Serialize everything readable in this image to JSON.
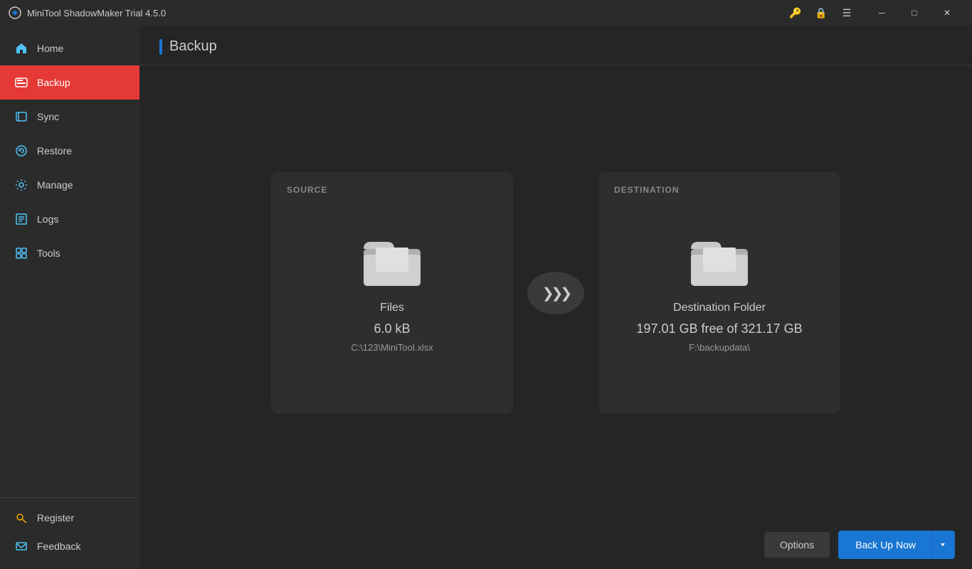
{
  "titleBar": {
    "appName": "MiniTool ShadowMaker Trial 4.5.0",
    "icons": [
      "key",
      "lock",
      "menu"
    ]
  },
  "sidebar": {
    "items": [
      {
        "id": "home",
        "label": "Home",
        "icon": "home"
      },
      {
        "id": "backup",
        "label": "Backup",
        "icon": "backup",
        "active": true
      },
      {
        "id": "sync",
        "label": "Sync",
        "icon": "sync"
      },
      {
        "id": "restore",
        "label": "Restore",
        "icon": "restore"
      },
      {
        "id": "manage",
        "label": "Manage",
        "icon": "manage"
      },
      {
        "id": "logs",
        "label": "Logs",
        "icon": "logs"
      },
      {
        "id": "tools",
        "label": "Tools",
        "icon": "tools"
      }
    ],
    "bottomItems": [
      {
        "id": "register",
        "label": "Register",
        "icon": "key"
      },
      {
        "id": "feedback",
        "label": "Feedback",
        "icon": "mail"
      }
    ]
  },
  "page": {
    "title": "Backup"
  },
  "source": {
    "label": "SOURCE",
    "type": "Files",
    "size": "6.0 kB",
    "path": "C:\\123\\MiniTool.xlsx"
  },
  "destination": {
    "label": "DESTINATION",
    "type": "Destination Folder",
    "freeSpace": "197.01 GB free of 321.17 GB",
    "path": "F:\\backupdata\\"
  },
  "bottomBar": {
    "optionsLabel": "Options",
    "backupNowLabel": "Back Up Now"
  }
}
